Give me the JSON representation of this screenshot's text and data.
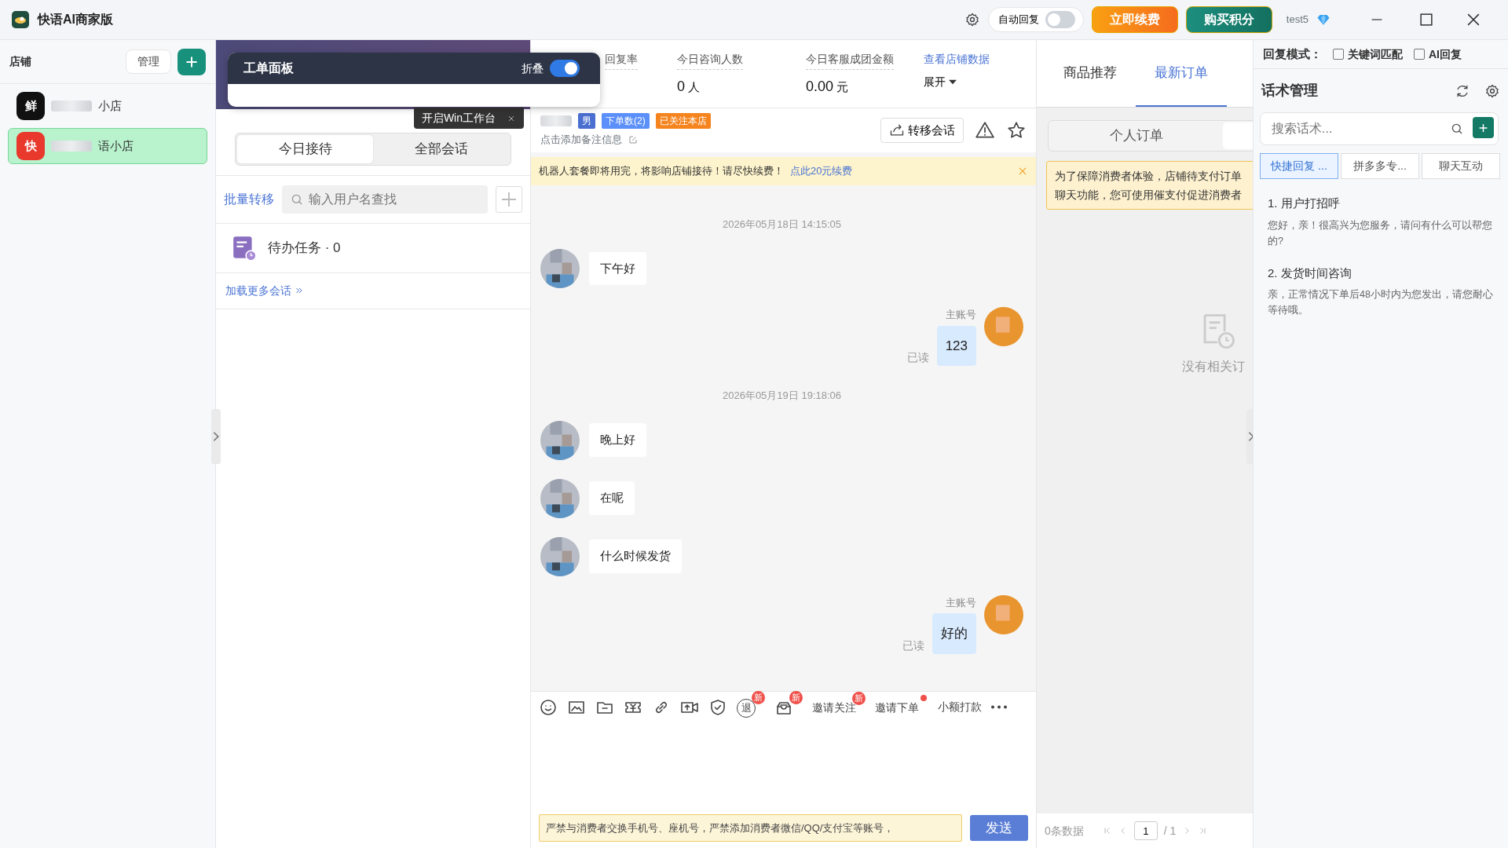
{
  "window": {
    "title": "快语AI商家版",
    "auto_reply": {
      "label": "自动回复",
      "on": false
    },
    "buttons": [
      {
        "label": "立即续费",
        "kind": "renew"
      },
      {
        "label": "购买积分",
        "kind": "points"
      }
    ],
    "user": "test5"
  },
  "shops": {
    "title": "店铺",
    "manage": "管理",
    "items": [
      {
        "badge": "鲜",
        "name": "小店",
        "color": "#111111",
        "selected": false
      },
      {
        "badge": "快",
        "name": "语小店",
        "color": "#e8392c",
        "selected": true
      }
    ]
  },
  "ticket_panel": {
    "title": "工单面板",
    "fold_label": "折叠",
    "folded": true
  },
  "hint": {
    "text": "开启Win工作台"
  },
  "sessions": {
    "tabs": [
      {
        "label": "今日接待",
        "selected": true
      },
      {
        "label": "全部会话",
        "selected": false
      }
    ],
    "batch": "批量转移",
    "search": {
      "placeholder": "输入用户名查找"
    },
    "pending": "待办任务 · 0",
    "load_more": "加载更多会话"
  },
  "stats": {
    "items": [
      {
        "label": "回复率"
      },
      {
        "label": "今日咨询人数",
        "value": "0",
        "unit": "人"
      },
      {
        "label": "今日客服成团金额",
        "value": "0.00",
        "unit": "元"
      }
    ],
    "link": "查看店铺数据",
    "expand": "展开"
  },
  "customer": {
    "tags": [
      {
        "text": "男",
        "color": "#4a6fd0"
      },
      {
        "text": "下单数(2)",
        "color": "#5b8ff9"
      },
      {
        "text": "已关注本店",
        "color": "#f5841f"
      }
    ],
    "note": "点击添加备注信息",
    "transfer": "转移会话"
  },
  "notice": {
    "text": "机器人套餐即将用完，将影响店铺接待！请尽快续费！",
    "link": "点此20元续费"
  },
  "messages": [
    {
      "kind": "time",
      "text": "2026年05月18日 14:15:05"
    },
    {
      "kind": "in",
      "text": "下午好"
    },
    {
      "kind": "out",
      "sender": "主账号",
      "text": "123",
      "status": "已读"
    },
    {
      "kind": "time",
      "text": "2026年05月19日 19:18:06"
    },
    {
      "kind": "in",
      "text": "晚上好"
    },
    {
      "kind": "in",
      "text": "在呢"
    },
    {
      "kind": "in",
      "text": "什么时候发货"
    },
    {
      "kind": "out",
      "sender": "主账号",
      "text": "好的",
      "status": "已读"
    }
  ],
  "toolbar": [
    {
      "kind": "icon"
    },
    {
      "kind": "icon"
    },
    {
      "kind": "icon"
    },
    {
      "kind": "icon"
    },
    {
      "kind": "icon"
    },
    {
      "kind": "icon"
    },
    {
      "kind": "icon"
    },
    {
      "kind": "glyph",
      "glyph": "退",
      "badge": "新"
    },
    {
      "kind": "icon",
      "badge": "新"
    },
    {
      "kind": "text",
      "text": "邀请关注",
      "badge": "新"
    },
    {
      "kind": "text",
      "text": "邀请下单",
      "dot": true
    },
    {
      "kind": "text",
      "text": "小额打款"
    },
    {
      "kind": "more"
    }
  ],
  "composer": {
    "warning": "严禁与消费者交换手机号、座机号，严禁添加消费者微信/QQ/支付宝等账号，",
    "send": "发送"
  },
  "orders": {
    "tabs": [
      {
        "label": "商品推荐",
        "selected": false
      },
      {
        "label": "最新订单",
        "selected": true
      }
    ],
    "subtabs": [
      {
        "label": "个人订单",
        "selected": false
      },
      {
        "selected": true
      }
    ],
    "warning_lines": [
      "为了保障消费者体验，店铺待支付订单",
      "聊天功能，您可使用催支付促进消费者"
    ],
    "empty": "没有相关订",
    "count": "0条数据",
    "page": "1",
    "pages": "/ 1"
  },
  "scripts": {
    "mode_label": "回复模式：",
    "modes": [
      {
        "label": "关键词匹配",
        "checked": false
      },
      {
        "label": "AI回复",
        "checked": false
      }
    ],
    "title": "话术管理",
    "search": {
      "placeholder": "搜索话术..."
    },
    "tabs": [
      {
        "label": "快捷回复 ...",
        "selected": true
      },
      {
        "label": "拼多多专...",
        "selected": false
      },
      {
        "label": "聊天互动",
        "selected": false
      }
    ],
    "items": [
      {
        "title": "1. 用户打招呼",
        "text": "您好，亲！很高兴为您服务，请问有什么可以帮您的?"
      },
      {
        "title": "2. 发货时间咨询",
        "text": "亲，正常情况下单后48小时内为您发出，请您耐心等待哦。"
      }
    ]
  }
}
